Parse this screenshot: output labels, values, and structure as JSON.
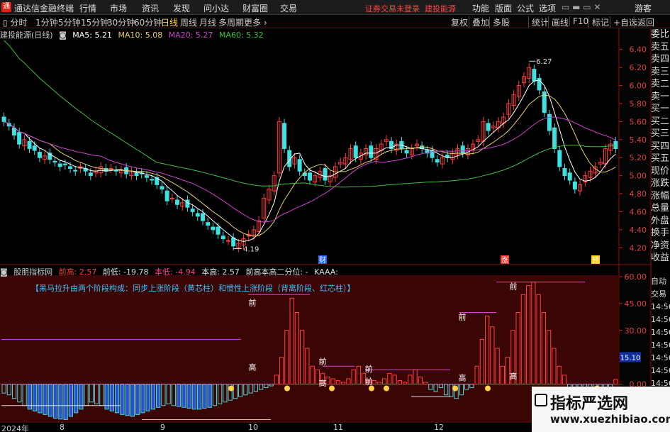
{
  "app": {
    "title": "通达信金融终端",
    "warning": "证券交易未登录",
    "stock_link": "建投能源"
  },
  "menu": [
    "行情",
    "市场",
    "资讯",
    "发现",
    "问小达",
    "财富圈",
    "交易"
  ],
  "right_menu": [
    "功能",
    "版面",
    "公式",
    "选项"
  ],
  "guest": "游客",
  "periods": [
    "分时",
    "1分钟",
    "5分钟",
    "15分钟",
    "30分钟",
    "60分钟",
    "日线",
    "周线",
    "月线",
    "多周期",
    "更多"
  ],
  "active_period": "日线",
  "tools": [
    "复权",
    "叠加",
    "多股",
    "统计",
    "画线",
    "F10",
    "标记",
    "+自选",
    "返回"
  ],
  "main_header": {
    "name": "建投能源(日线)",
    "ma5": "MA5: 5.21",
    "ma10": "MA10: 5.08",
    "ma20": "MA20: 5.27",
    "ma60": "MA60: 5.32"
  },
  "colors": {
    "ma5": "#ffffff",
    "ma10": "#e8d070",
    "ma20": "#d040d0",
    "ma60": "#40c040",
    "up": "#ff3b3b",
    "down": "#40e0e0"
  },
  "price_axis": [
    "6.40",
    "6.20",
    "6.00",
    "5.80",
    "5.60",
    "5.40",
    "5.20",
    "5.00",
    "4.80",
    "4.60",
    "4.40",
    "4.20"
  ],
  "high_label": "6.27",
  "low_label": "4.19",
  "event_markers": [
    "财",
    "涨",
    "预"
  ],
  "sub_header": {
    "name": "股朋指标网",
    "prev_high": "前高: 2.57",
    "prev_low": "前低: -19.78",
    "cur_low": "本低: -4.94",
    "cur_high": "本高: 2.57",
    "note": "前高本高二分位: -",
    "kaaa": "KAAA:"
  },
  "sub_title": "【黑马拉升由两个阶段构成：同步上涨阶段（黄芯柱）和惯性上涨阶段（背离阶段、红芯柱）】",
  "sub_axis": [
    "60.00",
    "45.00",
    "30.00",
    "15.10",
    "0.00"
  ],
  "sub_labels": [
    "前",
    "高",
    "前",
    "高",
    "前",
    "前",
    "前",
    "高",
    "前",
    "高"
  ],
  "right_quote_labels": [
    "委比",
    "卖五",
    "卖四",
    "卖三",
    "卖二",
    "卖一",
    "买一",
    "买二",
    "买三",
    "买四",
    "买五",
    "现价",
    "涨跌",
    "涨幅",
    "总量",
    "外盘",
    "换手",
    "净资",
    "收益"
  ],
  "right_quote_labels2": [
    "自动",
    "交易",
    "14:56",
    "14:56",
    "14:56",
    "14:56",
    "14:56",
    "14:56",
    "14:56"
  ],
  "x_axis": [
    "2024年",
    "8",
    "9",
    "10",
    "11",
    "12"
  ],
  "watermark": {
    "line1": "指标严选网",
    "line2": "www.xuezhibiao.com"
  },
  "chart_data": {
    "type": "candlestick",
    "ylim": [
      4.1,
      6.5
    ],
    "close": [
      5.6,
      5.55,
      5.45,
      5.35,
      5.4,
      5.3,
      5.28,
      5.2,
      5.22,
      5.18,
      5.15,
      5.1,
      5.12,
      5.08,
      5.05,
      5.1,
      5.05,
      5.0,
      5.05,
      5.1,
      5.05,
      5.08,
      5.05,
      5.06,
      5.02,
      5.05,
      5.0,
      5.02,
      4.98,
      4.95,
      4.9,
      4.85,
      4.72,
      4.75,
      4.68,
      4.7,
      4.65,
      4.6,
      4.55,
      4.5,
      4.45,
      4.4,
      4.35,
      4.3,
      4.28,
      4.22,
      4.25,
      4.3,
      4.35,
      4.4,
      4.5,
      4.75,
      4.85,
      5.0,
      5.6,
      5.3,
      5.1,
      5.2,
      5.05,
      5.0,
      4.95,
      5.0,
      5.05,
      4.95,
      5.0,
      5.1,
      5.15,
      5.2,
      5.3,
      5.2,
      5.25,
      5.3,
      5.2,
      5.3,
      5.35,
      5.4,
      5.3,
      5.35,
      5.3,
      5.25,
      5.3,
      5.35,
      5.3,
      5.25,
      5.2,
      5.15,
      5.2,
      5.2,
      5.25,
      5.3,
      5.25,
      5.3,
      5.35,
      5.4,
      5.6,
      5.5,
      5.55,
      5.6,
      5.65,
      5.8,
      5.9,
      6.0,
      6.1,
      6.2,
      6.05,
      5.95,
      5.7,
      5.5,
      5.3,
      5.1,
      5.0,
      4.95,
      4.85,
      4.9,
      5.0,
      5.05,
      5.1,
      5.15,
      5.3,
      5.35,
      5.3
    ],
    "sub_values": [
      -5,
      -6,
      -8,
      -10,
      -12,
      -14,
      -15,
      -16,
      -17,
      -18,
      -19,
      -19.5,
      -19.78,
      -18,
      -16,
      -14,
      -12,
      -10,
      -11,
      -12,
      -14,
      -15,
      -16,
      -17,
      -17.5,
      -18,
      -17,
      -16,
      -15,
      -14,
      -13,
      -12,
      -11,
      -12,
      -12.5,
      -13,
      -13.5,
      -14,
      -14,
      -13.5,
      -13,
      -12,
      -11,
      -10,
      -9,
      -8,
      -7,
      -6,
      -5,
      -4,
      -3,
      -2,
      -1,
      5,
      15,
      30,
      48,
      40,
      30,
      20,
      10,
      8,
      6,
      4,
      3,
      2,
      1,
      3,
      8,
      10,
      6,
      2,
      2,
      1,
      3,
      6,
      5,
      2,
      1,
      5,
      8,
      4,
      1,
      -3,
      -4,
      -2,
      -6,
      -7,
      -8,
      -6,
      -3,
      -2,
      10,
      25,
      38,
      32,
      20,
      10,
      15,
      30,
      40,
      50,
      55,
      57,
      50,
      40,
      30,
      20,
      10,
      5,
      -2,
      -3,
      -4,
      -4,
      -3,
      -2,
      -2,
      -3,
      -4.94,
      2.57
    ]
  }
}
